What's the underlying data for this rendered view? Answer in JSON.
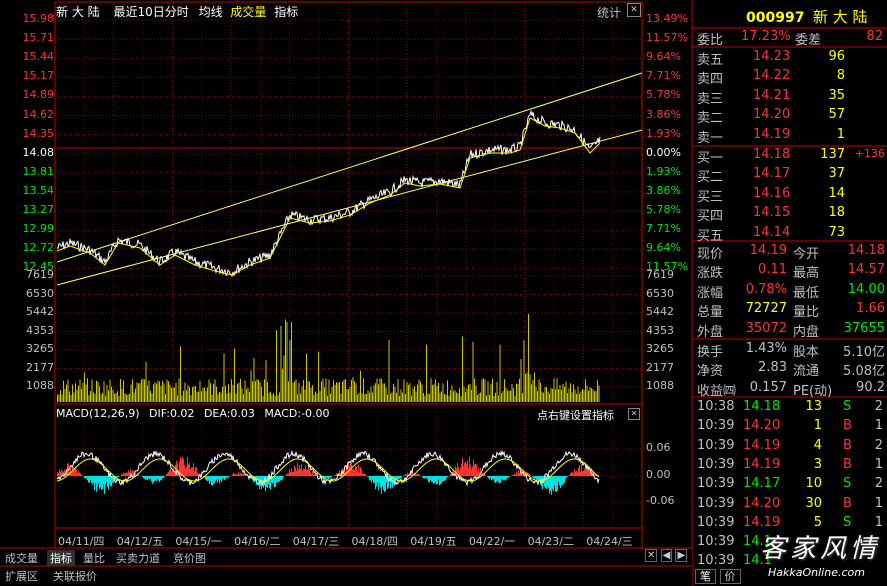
{
  "chart_header": {
    "stock_name": "新 大 陆",
    "period_label": "最近10日分时",
    "avg_line_label": "均线",
    "volume_label": "成交量",
    "indicator_label": "指标",
    "stats_button": "统计"
  },
  "price_axis": {
    "left": [
      "15.98",
      "15.71",
      "15.44",
      "15.17",
      "14.89",
      "14.62",
      "14.35",
      "14.08",
      "13.81",
      "13.54",
      "13.27",
      "12.99",
      "12.72",
      "12.45"
    ],
    "right": [
      "13.49%",
      "11.57%",
      "9.64%",
      "7.71%",
      "5.78%",
      "3.86%",
      "1.93%",
      "0.00%",
      "1.93%",
      "3.86%",
      "5.78%",
      "7.71%",
      "9.64%",
      "11.57%"
    ]
  },
  "volume_axis": [
    "7619",
    "6530",
    "5442",
    "4353",
    "3265",
    "2177",
    "1088"
  ],
  "macd": {
    "title": "MACD(12,26,9)",
    "dif": "DIF:0.02",
    "dea": "DEA:0.03",
    "macd": "MACD:-0.00",
    "hint": "点右键设置指标",
    "axis": [
      "0.06",
      "0.00",
      "-0.06"
    ]
  },
  "dates": [
    "04/11/四",
    "04/12/五",
    "04/15/一",
    "04/16/二",
    "04/17/三",
    "04/18/四",
    "04/19/五",
    "04/22/一",
    "04/23/二",
    "04/24/三"
  ],
  "bottom_tabs": [
    "成交量",
    "指标",
    "量比",
    "买卖力道",
    "竞价图"
  ],
  "bottom_tabs2": [
    "扩展区",
    "关联报价"
  ],
  "quote": {
    "code": "000997",
    "name": "新 大 陆",
    "wb_label": "委比",
    "wb_value": "17.23%",
    "wc_label": "委差",
    "wc_value": "82",
    "sells": [
      {
        "label": "卖五",
        "price": "14.23",
        "vol": "96"
      },
      {
        "label": "卖四",
        "price": "14.22",
        "vol": "8"
      },
      {
        "label": "卖三",
        "price": "14.21",
        "vol": "35"
      },
      {
        "label": "卖二",
        "price": "14.20",
        "vol": "57"
      },
      {
        "label": "卖一",
        "price": "14.19",
        "vol": "1"
      }
    ],
    "buys": [
      {
        "label": "买一",
        "price": "14.18",
        "vol": "137",
        "chg": "+136"
      },
      {
        "label": "买二",
        "price": "14.17",
        "vol": "37",
        "chg": ""
      },
      {
        "label": "买三",
        "price": "14.16",
        "vol": "14",
        "chg": ""
      },
      {
        "label": "买四",
        "price": "14.15",
        "vol": "18",
        "chg": ""
      },
      {
        "label": "买五",
        "price": "14.14",
        "vol": "73",
        "chg": ""
      }
    ],
    "stats": [
      {
        "l1": "现价",
        "v1": "14.19",
        "l2": "今开",
        "v2": "14.18"
      },
      {
        "l1": "涨跌",
        "v1": "0.11",
        "l2": "最高",
        "v2": "14.57"
      },
      {
        "l1": "涨幅",
        "v1": "0.78%",
        "l2": "最低",
        "v2": "14.00"
      },
      {
        "l1": "总量",
        "v1": "72727",
        "l2": "量比",
        "v2": "1.66"
      },
      {
        "l1": "外盘",
        "v1": "35072",
        "l2": "内盘",
        "v2": "37655"
      }
    ],
    "stats2": [
      {
        "l1": "换手",
        "v1": "1.43%",
        "l2": "股本",
        "v2": "5.10亿"
      },
      {
        "l1": "净资",
        "v1": "2.83",
        "l2": "流通",
        "v2": "5.08亿"
      },
      {
        "l1": "收益㈣",
        "v1": "0.157",
        "l2": "PE(动)",
        "v2": "90.2"
      }
    ]
  },
  "ticks": [
    {
      "time": "10:38",
      "price": "14.18",
      "vol": "13",
      "side": "S",
      "n": "2"
    },
    {
      "time": "10:39",
      "price": "14.20",
      "vol": "1",
      "side": "B",
      "n": "1"
    },
    {
      "time": "10:39",
      "price": "14.19",
      "vol": "4",
      "side": "B",
      "n": "2"
    },
    {
      "time": "10:39",
      "price": "14.19",
      "vol": "3",
      "side": "B",
      "n": "1"
    },
    {
      "time": "10:39",
      "price": "14.17",
      "vol": "10",
      "side": "S",
      "n": "2"
    },
    {
      "time": "10:39",
      "price": "14.20",
      "vol": "30",
      "side": "B",
      "n": "1"
    },
    {
      "time": "10:39",
      "price": "14.19",
      "vol": "5",
      "side": "S",
      "n": "1"
    },
    {
      "time": "10:39",
      "price": "14.1",
      "vol": "",
      "side": "",
      "n": ""
    },
    {
      "time": "10:39",
      "price": "14.1",
      "vol": "",
      "side": "",
      "n": ""
    }
  ],
  "right_tabs": [
    "笔",
    "价"
  ],
  "watermark": "客家风情",
  "watermark_url": "HakkaOnline.com"
}
